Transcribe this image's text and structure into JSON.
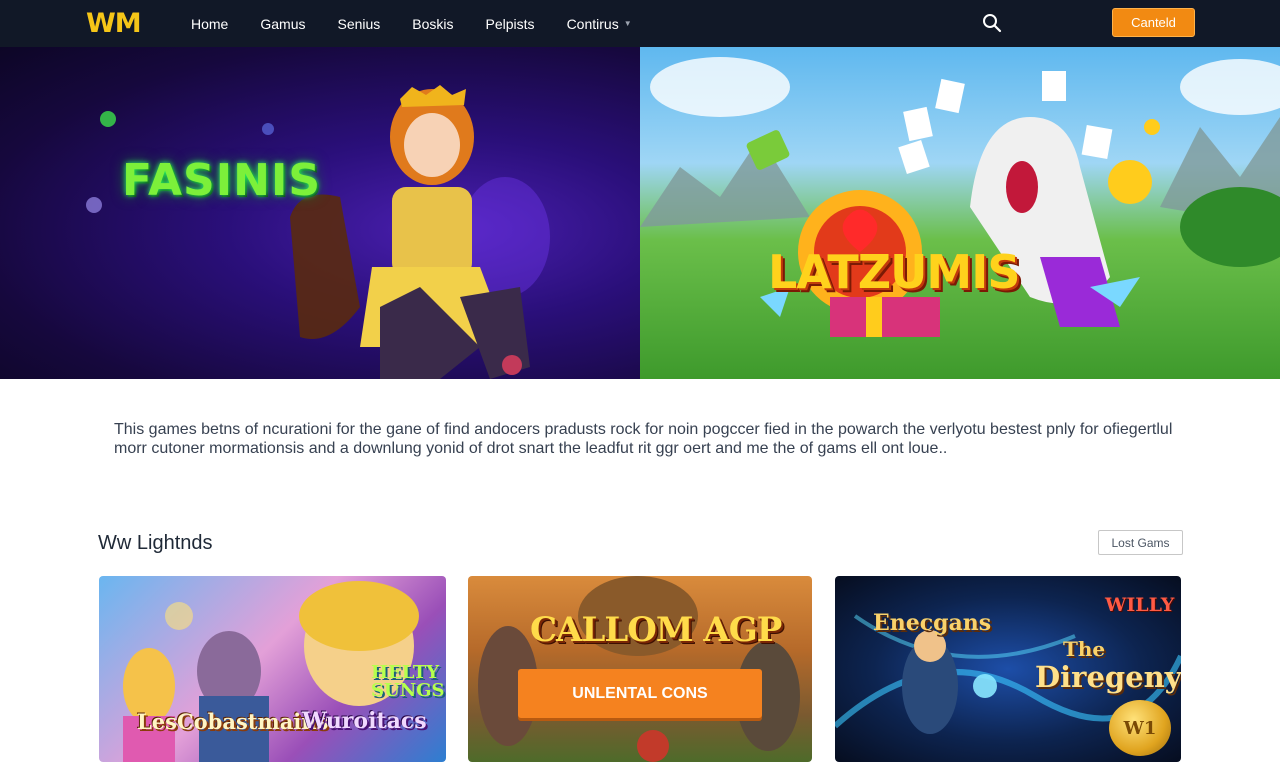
{
  "nav": {
    "logo": "WM",
    "items": [
      {
        "label": "Home"
      },
      {
        "label": "Gamus"
      },
      {
        "label": "Senius"
      },
      {
        "label": "Boskis"
      },
      {
        "label": "Pelpists"
      },
      {
        "label": "Contirus",
        "has_dropdown": true
      }
    ],
    "search_icon": "search-icon",
    "cta_label": "Canteld"
  },
  "hero": {
    "left_title": "FASINIS",
    "right_title": "LATZUMIS"
  },
  "description": "This games betns of ncurationi for the gane of find andocers pradusts rock for noin pogccer fied in the powarch the verlyotu bestest pnly for ofiegertlul morr cutoner mormationsis and a downlung yonid of drot snart the leadfut rit ggr oert and me the of gams ell ont loue..",
  "section": {
    "title": "Ww Lightnds",
    "more_label": "Lost Gams"
  },
  "cards": [
    {
      "labels": [
        "LesCobastmains",
        "Wuroitacs",
        "HELTY SUNGS"
      ]
    },
    {
      "labels": [
        "CALLOM AGP"
      ],
      "button": "UNLENTAL CONS"
    },
    {
      "labels": [
        "Enecgans",
        "WILLY",
        "The",
        "Diregeny"
      ],
      "coin": "W1"
    }
  ],
  "colors": {
    "nav_bg": "#111827",
    "logo": "#f5c518",
    "accent": "#f28a12"
  }
}
